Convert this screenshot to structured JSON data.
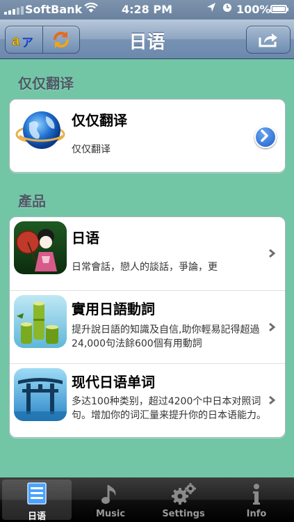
{
  "status_bar": {
    "carrier": "SoftBank",
    "time": "4:28 PM",
    "battery": "100%"
  },
  "nav": {
    "title": "日语",
    "left_segment_icons": [
      "dictionary-icon",
      "refresh-icon"
    ],
    "right_button_icon": "share-icon"
  },
  "sections": [
    {
      "header": "仅仅翻译",
      "items": [
        {
          "title": "仅仅翻译",
          "subtitle": "仅仅翻译",
          "icon": "globe-icon",
          "accessory": "detail-disclosure"
        }
      ]
    },
    {
      "header": "產品",
      "items": [
        {
          "title": "日语",
          "subtitle": "日常會話，戀人的談話，爭論，更",
          "icon": "geisha-icon",
          "accessory": "chevron"
        },
        {
          "title": "實用日語動詞",
          "subtitle": "提升說日語的知識及自信,助你輕易記得超過24,000句法餘600個有用動詞",
          "icon": "bamboo-icon",
          "accessory": "chevron"
        },
        {
          "title": "现代日语单词",
          "subtitle": "多达100种类别，超过4200个中日本对照词句。增加你的词汇量来提升你的日本语能力。",
          "icon": "torii-icon",
          "accessory": "chevron"
        }
      ]
    }
  ],
  "tabs": [
    {
      "label": "日语",
      "icon": "list-icon",
      "selected": true
    },
    {
      "label": "Music",
      "icon": "music-note-icon",
      "selected": false
    },
    {
      "label": "Settings",
      "icon": "gear-icon",
      "selected": false
    },
    {
      "label": "Info",
      "icon": "info-icon",
      "selected": false
    }
  ],
  "colors": {
    "background": "#72c6a5",
    "nav_bar": "#7792b3",
    "tab_bar": "#000000"
  }
}
